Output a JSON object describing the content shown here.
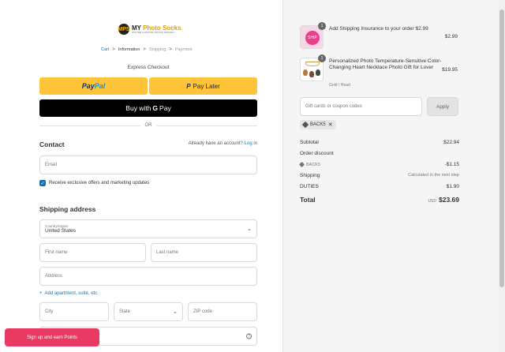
{
  "logo": {
    "mark": "MPS",
    "title_a": "MY ",
    "title_b": "Photo Socks",
    "subtitle": "ONLINE CUSTOM SOCKS DESIGN"
  },
  "breadcrumb": {
    "cart": "Cart",
    "information": "Information",
    "shipping": "Shipping",
    "payment": "Payment",
    "sep": ">"
  },
  "express": {
    "title": "Express Checkout",
    "paypal_a": "Pay",
    "paypal_b": "Pal",
    "paylater_p": "P",
    "paylater": "Pay Later",
    "gpay_prefix": "Buy with",
    "gpay_g": "G",
    "gpay_suffix": "Pay",
    "or": "OR"
  },
  "contact": {
    "heading": "Contact",
    "have_account": "Already have an account?",
    "login": "Log in",
    "email_placeholder": "Email",
    "offers_label": "Receive exclusive offers and marketing updates"
  },
  "shipping": {
    "heading": "Shipping address",
    "country_label": "Country/region",
    "country_value": "United States",
    "first_name": "First name",
    "last_name": "Last name",
    "address": "Address",
    "add_apartment": "Add apartment, suite, etc.",
    "city": "City",
    "state": "State",
    "zip": "ZIP code"
  },
  "signup": {
    "label": "Sign up and earn Points"
  },
  "order": {
    "items": [
      {
        "qty": "1",
        "title": "Add Shipping Insurance to your order $2.99",
        "price": "$2.99",
        "thumb_text": "SHIP"
      },
      {
        "qty": "1",
        "title": "Personalized Photo Temperature-Sensitive Color-Changing Heart Necklace Photo Gift for Lover",
        "variant": "Gold / Heart",
        "price": "$19.95"
      }
    ],
    "coupon_placeholder": "Gift cards or coupon codes",
    "apply": "Apply",
    "code": "BACK5",
    "subtotal_label": "Subtotal",
    "subtotal_value": "$22.94",
    "discount_label": "Order discount",
    "discount_code": "BACK5",
    "discount_value": "-$1.15",
    "shipping_label": "Shipping",
    "shipping_value": "Calculated in the next step",
    "duties_label": "DUTIES",
    "duties_value": "$1.90",
    "total_label": "Total",
    "currency": "USD",
    "total_value": "$23.69"
  }
}
